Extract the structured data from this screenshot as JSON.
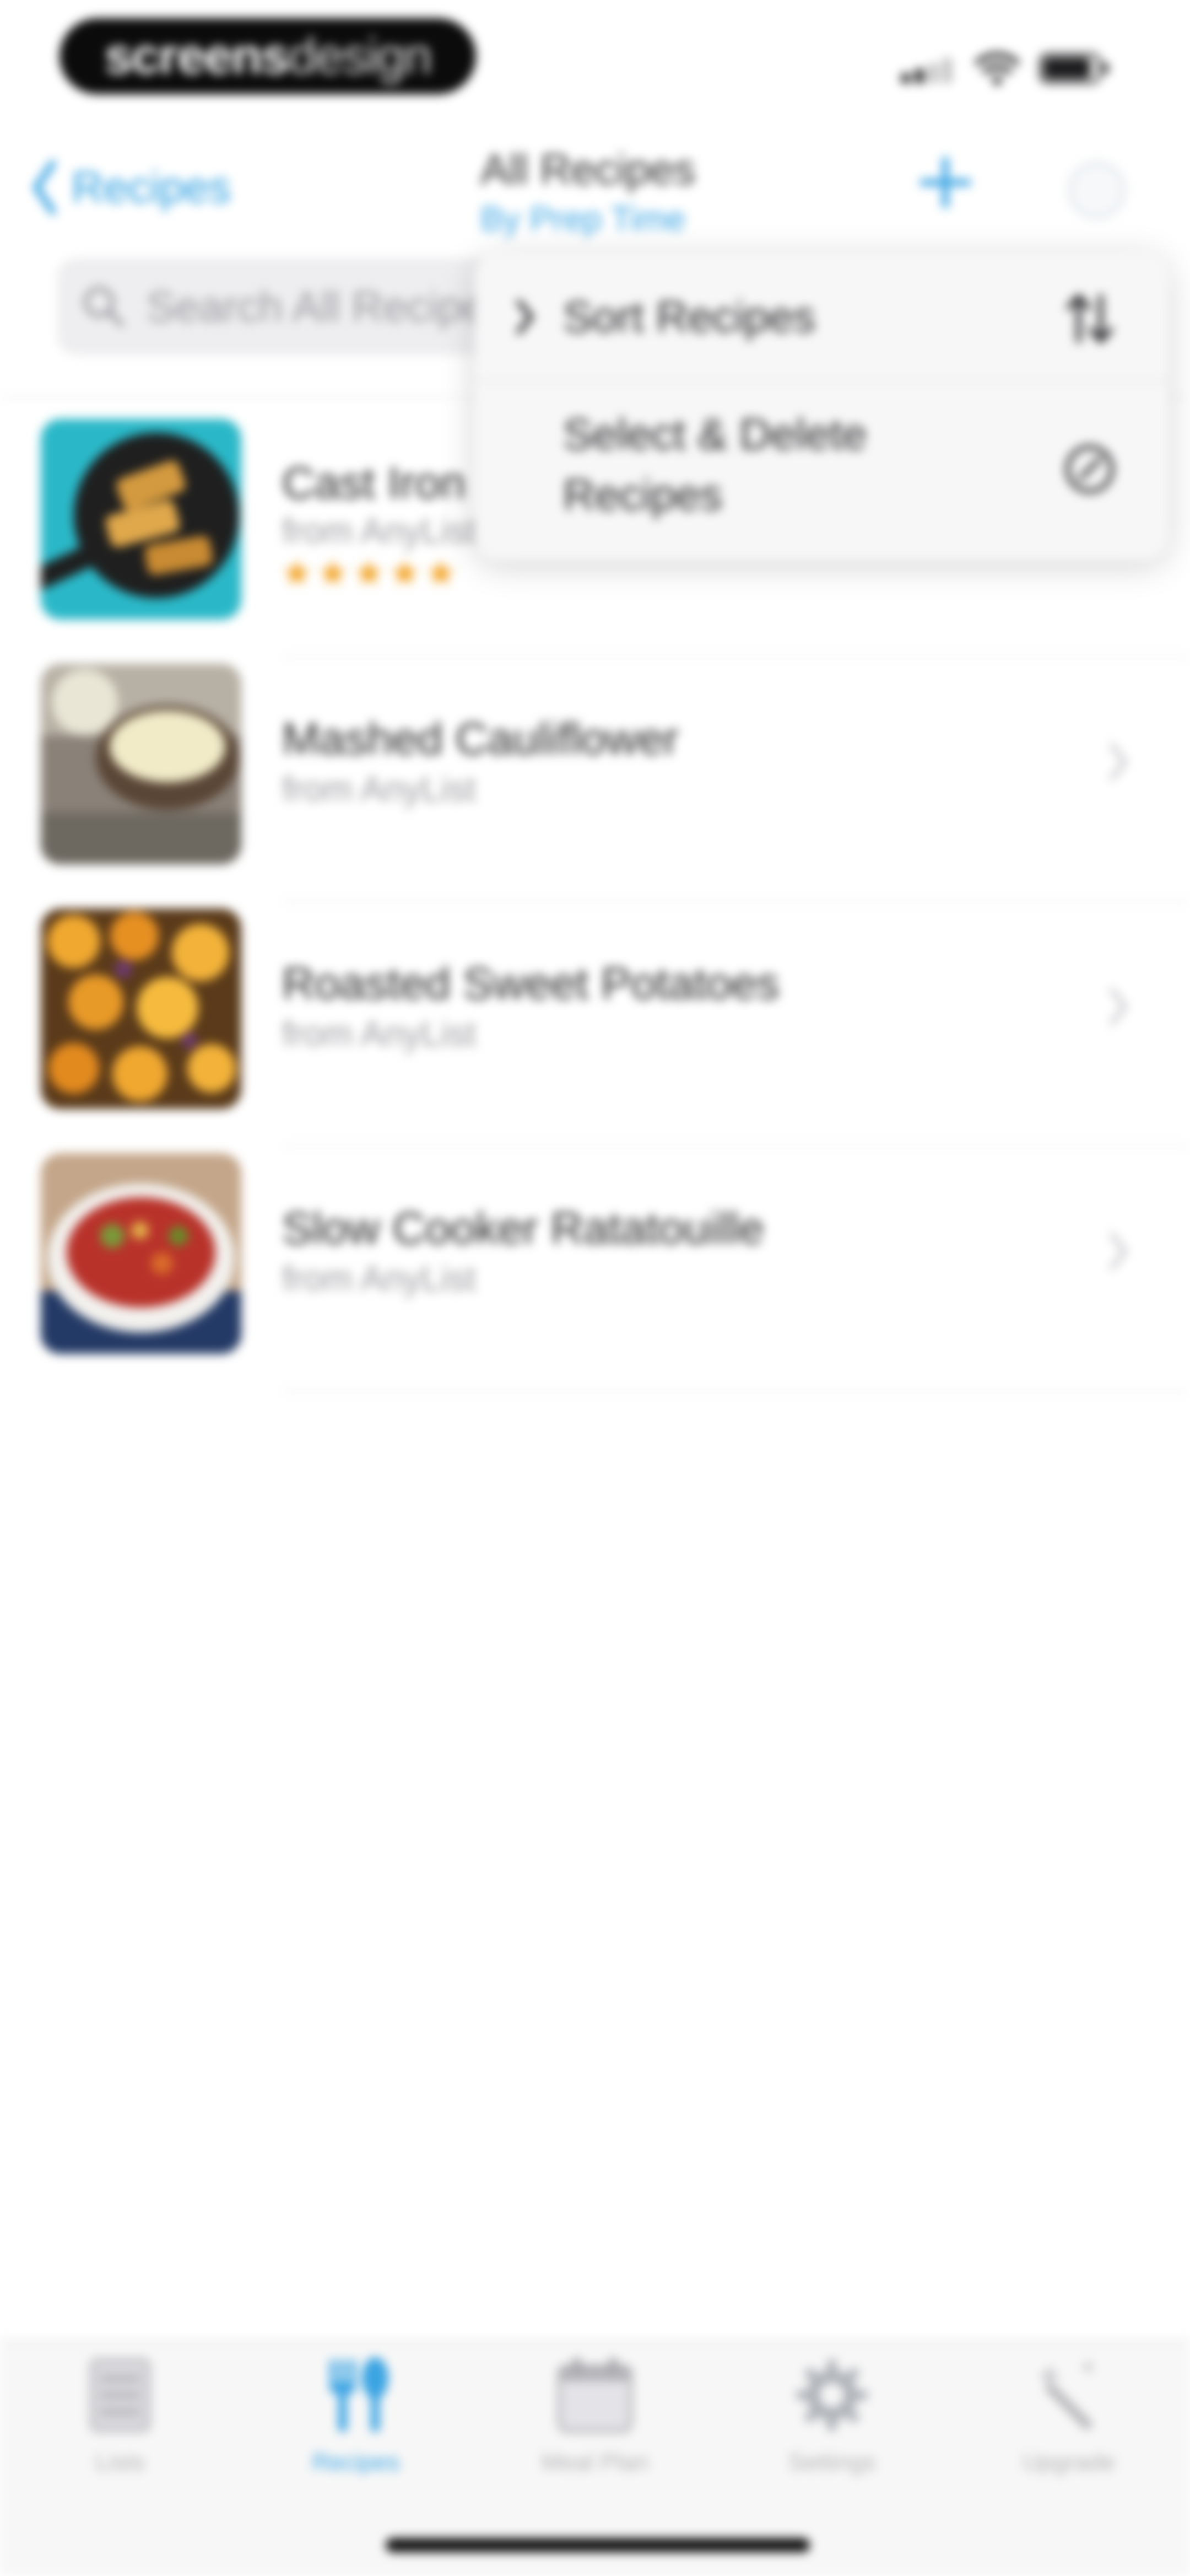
{
  "status_bar": {
    "badge_part1": "screens",
    "badge_part2": "design"
  },
  "nav": {
    "back_label": "Recipes",
    "title": "All Recipes",
    "subtitle": "By Prep Time"
  },
  "search": {
    "placeholder": "Search All Recipes"
  },
  "menu": {
    "items": [
      {
        "label": "Sort Recipes",
        "icon": "sort-arrows-icon"
      },
      {
        "label": "Select & Delete Recipes",
        "icon": "check-circle-icon"
      }
    ]
  },
  "recipes": [
    {
      "name": "Cast Iron",
      "source": "from AnyList",
      "rating": 5,
      "stars": "★★★★★"
    },
    {
      "name": "Mashed Cauliflower",
      "source": "from AnyList"
    },
    {
      "name": "Roasted Sweet Potatoes",
      "source": "from AnyList"
    },
    {
      "name": "Slow Cooker Ratatouille",
      "source": "from AnyList"
    }
  ],
  "tabs": [
    {
      "label": "Lists",
      "icon": "list-icon"
    },
    {
      "label": "Recipes",
      "icon": "fork-spoon-icon",
      "active": true
    },
    {
      "label": "Meal Plan",
      "icon": "calendar-icon"
    },
    {
      "label": "Settings",
      "icon": "gear-icon"
    },
    {
      "label": "Upgrade",
      "icon": "magic-wand-icon"
    }
  ],
  "colors": {
    "accent": "#3ba4e3",
    "star": "#f2a120"
  }
}
